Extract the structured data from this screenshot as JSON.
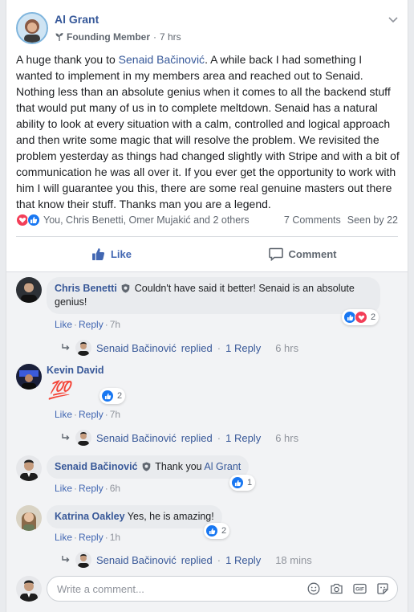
{
  "post": {
    "author": "Al Grant",
    "badge": "Founding Member",
    "time": "7 hrs",
    "body_pre": "A huge thank you to ",
    "mention": "Senaid Bačinović",
    "body_post": ". A while back I had something I wanted to implement in my members area and reached out to Senaid. Nothing less than an absolute genius when it comes to all the backend stuff that would put many of us in to complete meltdown. Senaid has a natural ability to look at every situation with a calm, controlled and logical approach and then write some magic that will resolve the problem. We revisited the problem yesterday as things had changed slightly with Stripe and with a bit of communication he was all over it. If you ever get the opportunity to work with him I will guarantee you this, there are some real genuine masters out there that know their stuff. Thanks man you are a legend."
  },
  "stats": {
    "reactors": "You, Chris Benetti, Omer Mujakić and 2 others",
    "comments": "7 Comments",
    "seen": "Seen by 22"
  },
  "actions": {
    "like": "Like",
    "comment": "Comment"
  },
  "comments": [
    {
      "name": "Chris Benetti",
      "text": "Couldn't have said it better! Senaid is an absolute genius!",
      "like": "Like",
      "reply": "Reply",
      "time": "7h",
      "reactions": "2",
      "replies": {
        "name": "Senaid Bačinović",
        "replied": "replied",
        "count": "1 Reply",
        "time": "6 hrs"
      }
    },
    {
      "name": "Kevin David",
      "emoji": "💯",
      "like": "Like",
      "reply": "Reply",
      "time": "7h",
      "reactions": "2",
      "replies": {
        "name": "Senaid Bačinović",
        "replied": "replied",
        "count": "1 Reply",
        "time": "6 hrs"
      }
    },
    {
      "name": "Senaid Bačinović",
      "text": "Thank you ",
      "mention": "Al Grant",
      "like": "Like",
      "reply": "Reply",
      "time": "6h",
      "reactions": "1"
    },
    {
      "name": "Katrina Oakley",
      "text": "Yes, he is amazing!",
      "like": "Like",
      "reply": "Reply",
      "time": "1h",
      "reactions": "2",
      "replies": {
        "name": "Senaid Bačinović",
        "replied": "replied",
        "count": "1 Reply",
        "time": "18 mins"
      }
    }
  ],
  "composer": {
    "placeholder": "Write a comment..."
  },
  "colors": {
    "link": "#365899",
    "like_blue": "#1877f2",
    "love_red": "#f33e58",
    "meta_gray": "#606770"
  }
}
